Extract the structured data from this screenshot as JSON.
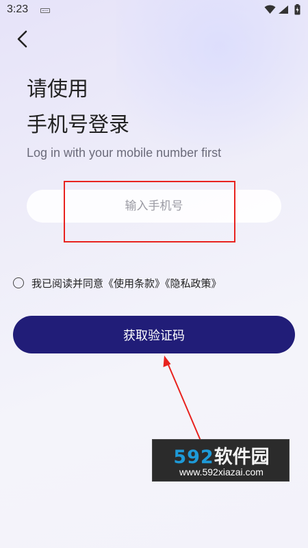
{
  "status_bar": {
    "time": "3:23",
    "icons": [
      "keyboard-icon",
      "wifi-icon",
      "signal-icon",
      "battery-icon"
    ]
  },
  "header": {
    "back_icon": "chevron-left-icon"
  },
  "title": {
    "line1": "请使用",
    "line2": "手机号登录"
  },
  "subtitle": "Log in with your mobile number first",
  "phone_input": {
    "placeholder": "输入手机号",
    "value": ""
  },
  "agreement": {
    "checked": false,
    "text": "我已阅读并同意",
    "terms_link": "《使用条款》",
    "privacy_link": "《隐私政策》"
  },
  "get_code_button": {
    "label": "获取验证码"
  },
  "annotations": {
    "highlight_color": "#e8221e",
    "arrow_color": "#e8221e"
  },
  "watermark": {
    "brand_number": "592",
    "brand_name": "软件园",
    "url": "www.592xiazai.com"
  },
  "colors": {
    "primary_button": "#211d78",
    "background": "#eeedf9"
  }
}
